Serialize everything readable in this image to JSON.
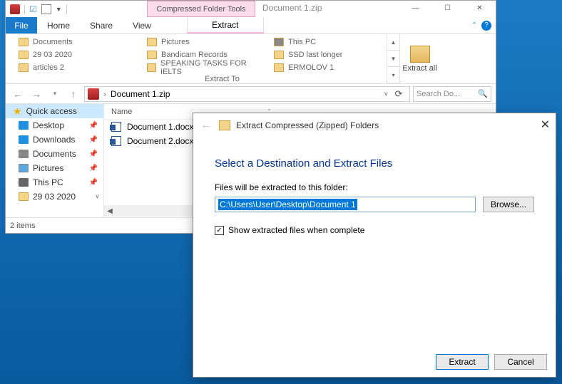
{
  "titlebar": {
    "tools_tab": "Compressed Folder Tools",
    "document": "Document 1.zip"
  },
  "menu": {
    "file": "File",
    "home": "Home",
    "share": "Share",
    "view": "View",
    "extract": "Extract"
  },
  "ribbon": {
    "col1": [
      "Documents",
      "29 03 2020",
      "articles 2"
    ],
    "col2": [
      "Pictures",
      "Bandicam Records",
      "SPEAKING TASKS FOR IELTS"
    ],
    "col3": [
      "This PC",
      "SSD last longer",
      "ERMOLOV 1"
    ],
    "extract_all": "Extract\nall",
    "section_label": "Extract To"
  },
  "address": {
    "path": "Document 1.zip",
    "search_placeholder": "Search Do..."
  },
  "nav": {
    "quick_access": "Quick access",
    "items": [
      {
        "label": "Desktop"
      },
      {
        "label": "Downloads"
      },
      {
        "label": "Documents"
      },
      {
        "label": "Pictures"
      },
      {
        "label": "This PC"
      },
      {
        "label": "29 03 2020"
      }
    ]
  },
  "filelist": {
    "header_name": "Name",
    "rows": [
      "Document 1.docx",
      "Document 2.docx"
    ]
  },
  "status": {
    "items_text": "2 items"
  },
  "dialog": {
    "title": "Extract Compressed (Zipped) Folders",
    "heading": "Select a Destination and Extract Files",
    "folder_label": "Files will be extracted to this folder:",
    "path_value": "C:\\Users\\User\\Desktop\\Document 1",
    "browse": "Browse...",
    "show_extracted": "Show extracted files when complete",
    "extract": "Extract",
    "cancel": "Cancel"
  }
}
